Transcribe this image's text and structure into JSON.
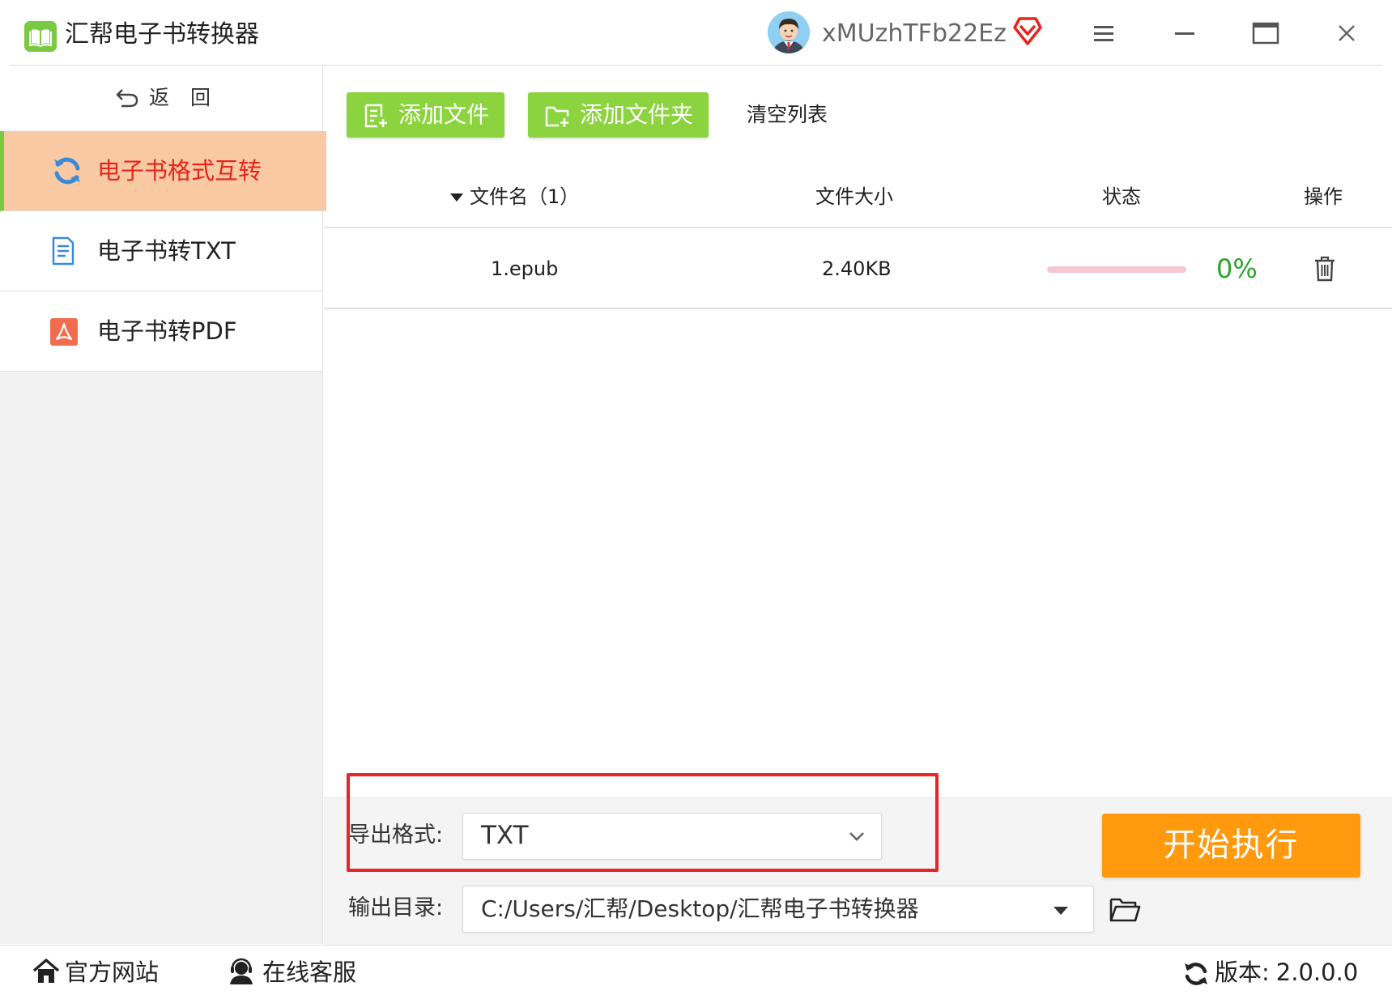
{
  "titlebar": {
    "app_title": "汇帮电子书转换器",
    "username": "xMUzhTFb22Ez",
    "icons": [
      "book-icon",
      "avatar",
      "vip-diamond-icon",
      "menu-icon",
      "minimize-icon",
      "maximize-icon",
      "close-icon"
    ]
  },
  "sidebar": {
    "back_label": "返回",
    "items": [
      {
        "label": "电子书格式互转",
        "icon": "convert-icon",
        "active": true
      },
      {
        "label": "电子书转TXT",
        "icon": "txt-document-icon",
        "active": false
      },
      {
        "label": "电子书转PDF",
        "icon": "pdf-icon",
        "active": false
      }
    ]
  },
  "toolbar": {
    "add_file": "添加文件",
    "add_folder": "添加文件夹",
    "clear_list": "清空列表"
  },
  "table": {
    "headers": {
      "filename": "文件名（1）",
      "size": "文件大小",
      "status": "状态",
      "action": "操作"
    },
    "rows": [
      {
        "filename": "1.epub",
        "size": "2.40KB",
        "progress": 0,
        "percent_text": "0%"
      }
    ]
  },
  "settings": {
    "format_label": "导出格式:",
    "format_value": "TXT",
    "output_label": "输出目录:",
    "output_value": "C:/Users/汇帮/Desktop/汇帮电子书转换器",
    "start_button": "开始执行"
  },
  "footer": {
    "website": "官方网站",
    "support": "在线客服",
    "version_label": "版本:",
    "version_value": "2.0.0.0"
  },
  "colors": {
    "accent_green": "#7ac943",
    "button_green": "#8cd43f",
    "active_bg": "#f8c9a2",
    "active_text": "#e8231c",
    "start_orange": "#ff9a0f",
    "progress_pink": "#f7c6d3",
    "percent_green": "#2aa52a",
    "highlight_red": "#e42626"
  }
}
